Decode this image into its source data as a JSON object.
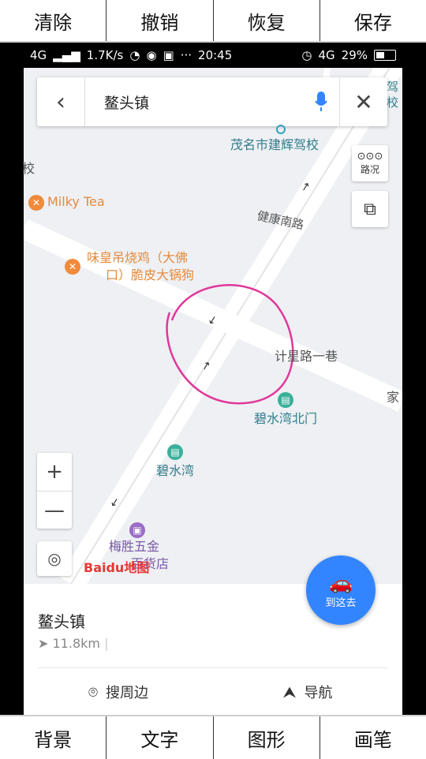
{
  "top_toolbar": {
    "items": [
      "清除",
      "撤销",
      "恢复",
      "保存"
    ]
  },
  "bottom_toolbar": {
    "items": [
      "背景",
      "文字",
      "图形",
      "画笔"
    ]
  },
  "status_bar": {
    "network": "4G",
    "speed": "1.7K/s",
    "more": "···",
    "time": "20:45",
    "network_right": "4G",
    "battery": "29%"
  },
  "search": {
    "back": "‹",
    "query": "鳌头镇",
    "close": "✕"
  },
  "map": {
    "pois": {
      "driving_school": "茂名市建辉驾校",
      "milky_tea": "Milky Tea",
      "chicken": "味皇吊烧鸡（大佛",
      "chicken2": "口）脆皮大锅狗",
      "road1": "健康南路",
      "road2": "计星路一巷",
      "bishui_north": "碧水湾北门",
      "bishui": "碧水湾",
      "hardware1": "梅胜五金",
      "hardware2": "百货店",
      "edge_left": "校",
      "edge_right_top": "驾",
      "edge_right_top2": "校",
      "edge_right": "家",
      "logo": "Baidu地图"
    },
    "traffic_label": "路况",
    "zoom_in": "+",
    "zoom_out": "—"
  },
  "goto_button": {
    "label": "到这去"
  },
  "bottom_panel": {
    "title": "鳌头镇",
    "distance": "11.8km",
    "search_nearby": "搜周边",
    "navigate": "导航"
  },
  "colors": {
    "accent": "#3385ff",
    "poi_orange": "#e58a3c",
    "annotation": "#e0379b"
  }
}
